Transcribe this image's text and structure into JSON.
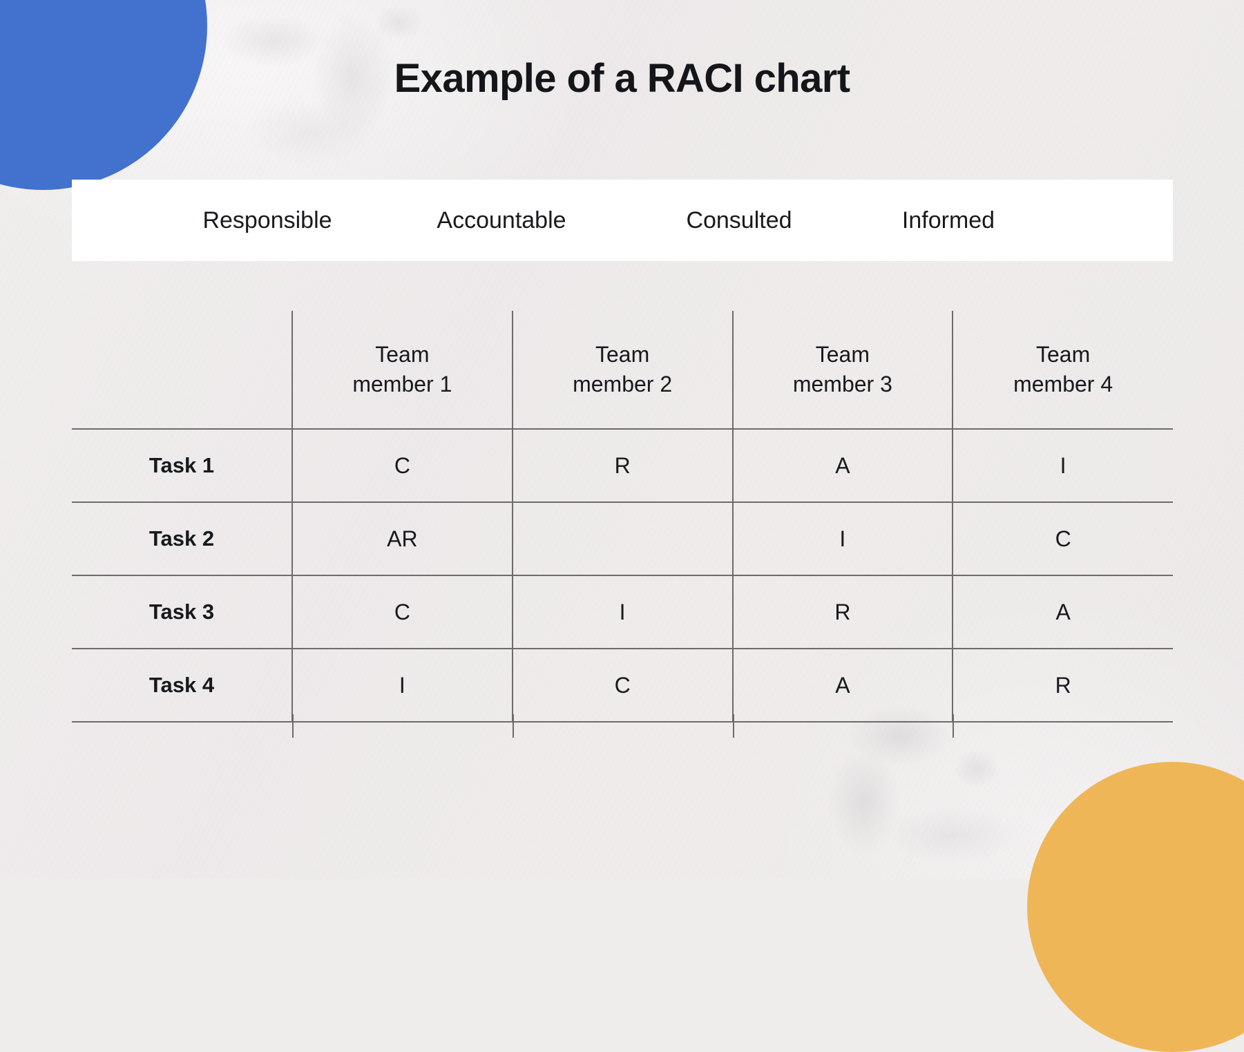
{
  "page": {
    "title": "Example of a RACI chart",
    "background_color": "#EFECEC"
  },
  "decorations": {
    "circle_blue": {
      "name": "blue-circle",
      "color": "#4272CE"
    },
    "circle_orange": {
      "name": "orange-circle",
      "color": "#EFB658"
    },
    "marble_top": {
      "name": "marble-texture-top"
    },
    "marble_bottom": {
      "name": "marble-texture-bottom"
    }
  },
  "legend": {
    "background_color": "#FFFFFF",
    "items": [
      {
        "label": "Responsible",
        "letter": "R"
      },
      {
        "label": "Accountable",
        "letter": "A"
      },
      {
        "label": "Consulted",
        "letter": "C"
      },
      {
        "label": "Informed",
        "letter": "I"
      }
    ]
  },
  "chart_data": {
    "type": "table",
    "title": "Example of a RACI chart",
    "corner_header": "",
    "columns": [
      "Team\nmember 1",
      "Team\nmember 2",
      "Team\nmember 3",
      "Team\nmember 4"
    ],
    "column_lines": [
      {
        "line1": "Team",
        "line2": "member 1"
      },
      {
        "line1": "Team",
        "line2": "member 2"
      },
      {
        "line1": "Team",
        "line2": "member 3"
      },
      {
        "line1": "Team",
        "line2": "member 4"
      }
    ],
    "rows": [
      {
        "task": "Task 1",
        "values": [
          "C",
          "R",
          "A",
          "I"
        ]
      },
      {
        "task": "Task 2",
        "values": [
          "AR",
          "",
          "I",
          "C"
        ]
      },
      {
        "task": "Task 3",
        "values": [
          "C",
          "I",
          "R",
          "A"
        ]
      },
      {
        "task": "Task 4",
        "values": [
          "I",
          "C",
          "A",
          "R"
        ]
      }
    ],
    "legend": [
      "Responsible",
      "Accountable",
      "Consulted",
      "Informed"
    ],
    "grid": true,
    "line_color": "#6E6A6C"
  }
}
